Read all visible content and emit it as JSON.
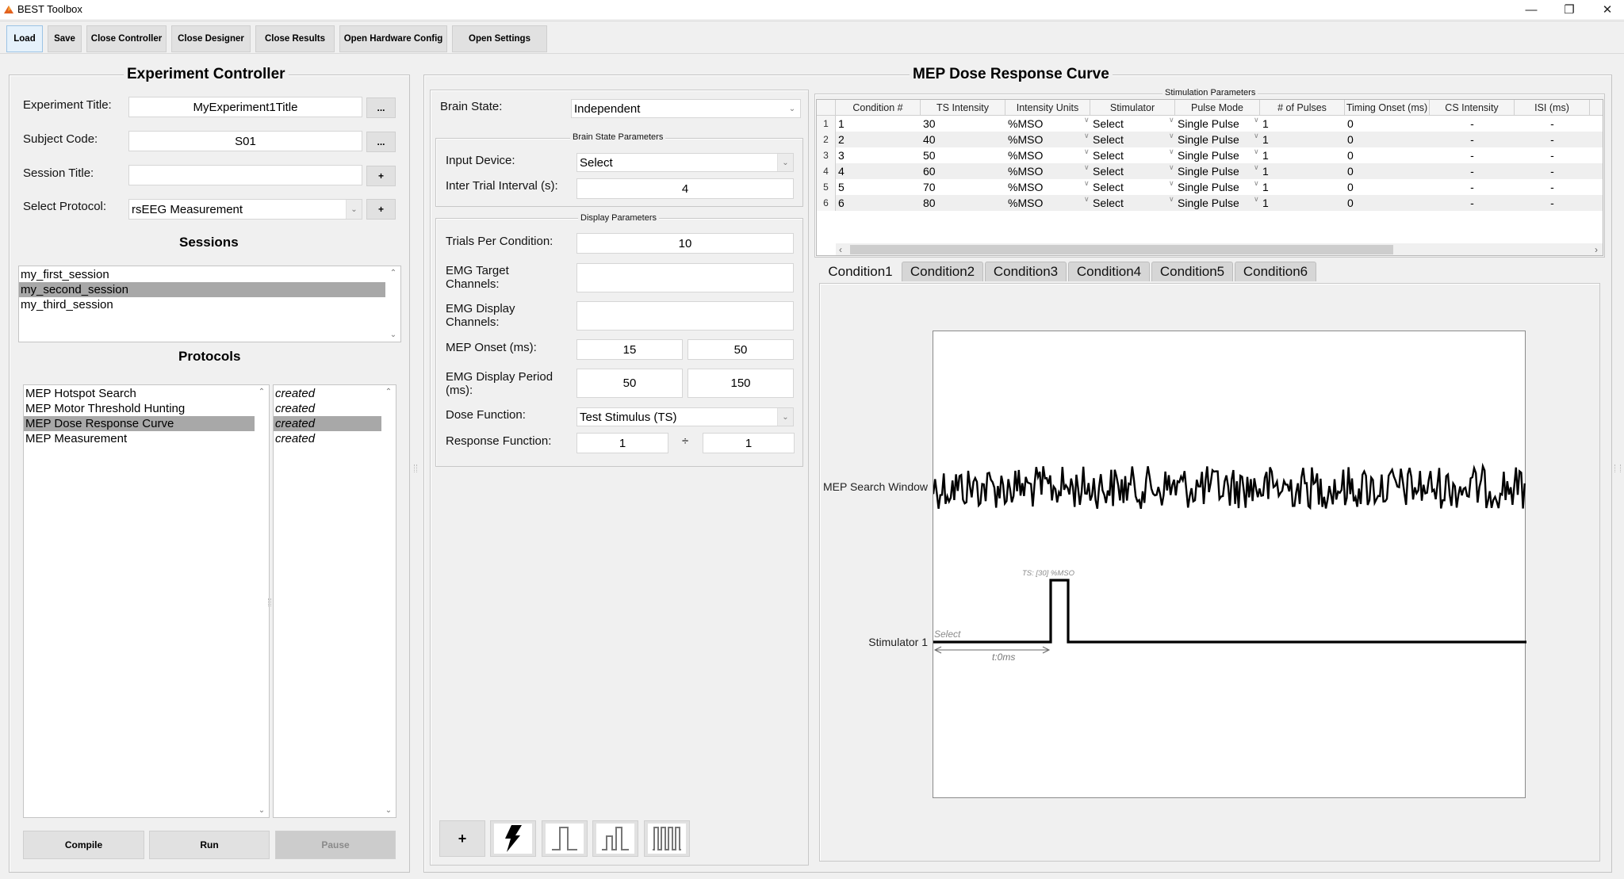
{
  "window": {
    "title": "BEST Toolbox",
    "controls": {
      "minimize": "—",
      "restore": "❐",
      "close": "✕"
    }
  },
  "toolbar": {
    "buttons": [
      {
        "label": "Load",
        "active": true
      },
      {
        "label": "Save"
      },
      {
        "label": "Close Controller"
      },
      {
        "label": "Close Designer"
      },
      {
        "label": "Close Results"
      },
      {
        "label": "Open Hardware Config"
      },
      {
        "label": "Open Settings"
      }
    ]
  },
  "controller": {
    "title": "Experiment Controller",
    "experiment_title_label": "Experiment Title:",
    "experiment_title_value": "MyExperiment1Title",
    "subject_code_label": "Subject Code:",
    "subject_code_value": "S01",
    "session_title_label": "Session Title:",
    "session_title_value": "",
    "select_protocol_label": "Select Protocol:",
    "select_protocol_value": "rsEEG Measurement",
    "browse_label": "...",
    "add_label": "+",
    "sessions_heading": "Sessions",
    "sessions": [
      "my_first_session",
      "my_second_session",
      "my_third_session"
    ],
    "sessions_selected_index": 1,
    "protocols_heading": "Protocols",
    "protocols": [
      "MEP Hotspot Search",
      "MEP Motor Threshold Hunting",
      "MEP Dose Response Curve",
      "MEP Measurement"
    ],
    "protocol_status": [
      "created",
      "created",
      "created",
      "created"
    ],
    "protocols_selected_index": 2,
    "compile_label": "Compile",
    "run_label": "Run",
    "pause_label": "Pause"
  },
  "designer": {
    "title": "MEP Dose Response Curve",
    "brain_state_label": "Brain State:",
    "brain_state_value": "Independent",
    "brain_state_params_title": "Brain State Parameters",
    "input_device_label": "Input Device:",
    "input_device_value": "Select",
    "iti_label": "Inter Trial Interval (s):",
    "iti_value": "4",
    "display_params_title": "Display Parameters",
    "trials_label": "Trials Per Condition:",
    "trials_value": "10",
    "emg_target_label_1": "EMG Target",
    "emg_target_label_2": "Channels:",
    "emg_target_value": "",
    "emg_display_label_1": "EMG Display",
    "emg_display_label_2": "Channels:",
    "emg_display_value": "",
    "mep_onset_label": "MEP Onset (ms):",
    "mep_onset_from": "15",
    "mep_onset_to": "50",
    "emg_period_label_1": "EMG Display Period",
    "emg_period_label_2": "(ms):",
    "emg_period_from": "50",
    "emg_period_to": "150",
    "dose_function_label": "Dose Function:",
    "dose_function_value": "Test Stimulus (TS)",
    "response_function_label": "Response Function:",
    "response_function_a": "1",
    "response_function_op": "÷",
    "response_function_b": "1",
    "add_condition_label": "+"
  },
  "stimulation": {
    "group_title": "Stimulation Parameters",
    "columns": [
      "Condition #",
      "TS Intensity",
      "Intensity Units",
      "Stimulator",
      "Pulse Mode",
      "# of Pulses",
      "Timing Onset (ms)",
      "CS Intensity",
      "ISI (ms)"
    ],
    "rows": [
      {
        "n": "1",
        "cond": "1",
        "ts": "30",
        "units": "%MSO",
        "stim": "Select",
        "mode": "Single Pulse",
        "pulses": "1",
        "onset": "0",
        "cs": "-",
        "isi": "-"
      },
      {
        "n": "2",
        "cond": "2",
        "ts": "40",
        "units": "%MSO",
        "stim": "Select",
        "mode": "Single Pulse",
        "pulses": "1",
        "onset": "0",
        "cs": "-",
        "isi": "-"
      },
      {
        "n": "3",
        "cond": "3",
        "ts": "50",
        "units": "%MSO",
        "stim": "Select",
        "mode": "Single Pulse",
        "pulses": "1",
        "onset": "0",
        "cs": "-",
        "isi": "-"
      },
      {
        "n": "4",
        "cond": "4",
        "ts": "60",
        "units": "%MSO",
        "stim": "Select",
        "mode": "Single Pulse",
        "pulses": "1",
        "onset": "0",
        "cs": "-",
        "isi": "-"
      },
      {
        "n": "5",
        "cond": "5",
        "ts": "70",
        "units": "%MSO",
        "stim": "Select",
        "mode": "Single Pulse",
        "pulses": "1",
        "onset": "0",
        "cs": "-",
        "isi": "-"
      },
      {
        "n": "6",
        "cond": "6",
        "ts": "80",
        "units": "%MSO",
        "stim": "Select",
        "mode": "Single Pulse",
        "pulses": "1",
        "onset": "0",
        "cs": "-",
        "isi": "-"
      }
    ]
  },
  "condition_tabs": [
    "Condition1",
    "Condition2",
    "Condition3",
    "Condition4",
    "Condition5",
    "Condition6"
  ],
  "condition_active_index": 0,
  "preview": {
    "mep_label": "MEP Search Window",
    "stimulator_label": "Stimulator 1",
    "stimulator_select": "Select",
    "pulse_label": "TS: [30] %MSO",
    "timing_label": "t:0ms"
  }
}
